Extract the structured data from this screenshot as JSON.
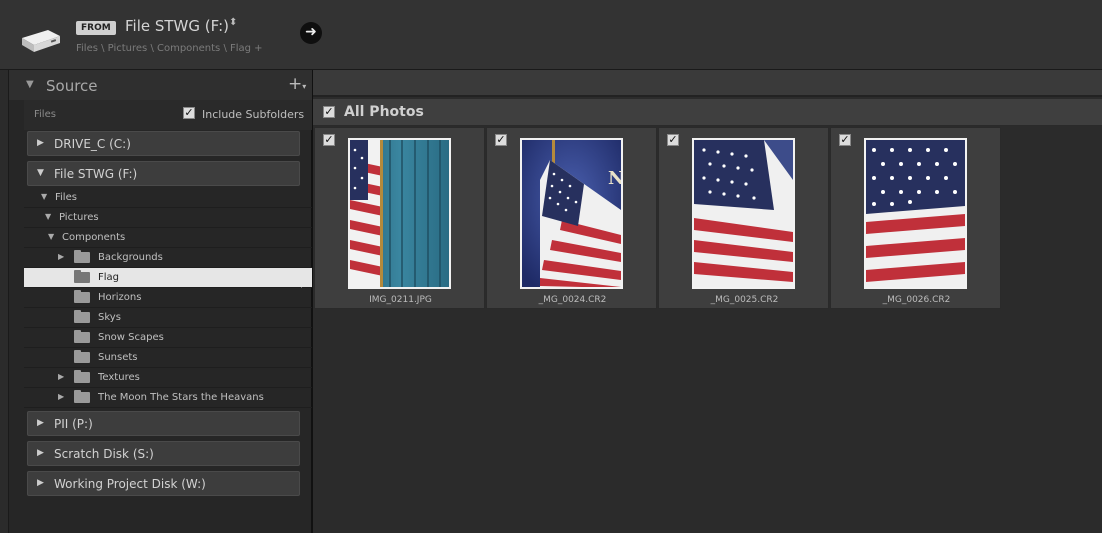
{
  "header": {
    "from_label": "FROM",
    "source_name": "File STWG (F:)",
    "updown_symbol": "⬍",
    "breadcrumb": "Files \\ Pictures \\ Components \\ Flag +",
    "go_symbol": "➜"
  },
  "left_panel": {
    "title": "Source",
    "add_symbol": "+",
    "files_label": "Files",
    "include_subfolders_label": "Include Subfolders",
    "include_subfolders_checked": true,
    "volumes_top": [
      {
        "label": "DRIVE_C (C:)",
        "expanded": false
      },
      {
        "label": "File STWG (F:)",
        "expanded": true
      }
    ],
    "tree": [
      {
        "label": "Files",
        "expanded": true,
        "folder": false
      },
      {
        "label": "Pictures",
        "expanded": true,
        "folder": false
      },
      {
        "label": "Components",
        "expanded": true,
        "folder": false
      },
      {
        "label": "Backgrounds",
        "has_children": true,
        "folder": true
      },
      {
        "label": "Flag",
        "selected": true,
        "folder": true
      },
      {
        "label": "Horizons",
        "folder": true
      },
      {
        "label": "Skys",
        "folder": true
      },
      {
        "label": "Snow Scapes",
        "folder": true
      },
      {
        "label": "Sunsets",
        "folder": true
      },
      {
        "label": "Textures",
        "has_children": true,
        "folder": true
      },
      {
        "label": "The Moon The Stars the Heavans",
        "has_children": true,
        "folder": true
      }
    ],
    "volumes_bottom": [
      {
        "label": "PII (P:)",
        "expanded": false
      },
      {
        "label": "Scratch Disk (S:)",
        "expanded": false
      },
      {
        "label": "Working Project Disk (W:)",
        "expanded": false
      }
    ]
  },
  "main": {
    "section_title": "All Photos",
    "section_checked": true,
    "photos": [
      {
        "filename": "IMG_0211.JPG",
        "checked": true
      },
      {
        "filename": "_MG_0024.CR2",
        "checked": true
      },
      {
        "filename": "_MG_0025.CR2",
        "checked": true
      },
      {
        "filename": "_MG_0026.CR2",
        "checked": true
      }
    ]
  },
  "colors": {
    "background": "#2b2b2b",
    "panel": "#262626",
    "selected_row": "#e6e6e6",
    "flag_red": "#c0303a",
    "flag_blue": "#27305e",
    "curtain_teal": "#2f6f86"
  }
}
